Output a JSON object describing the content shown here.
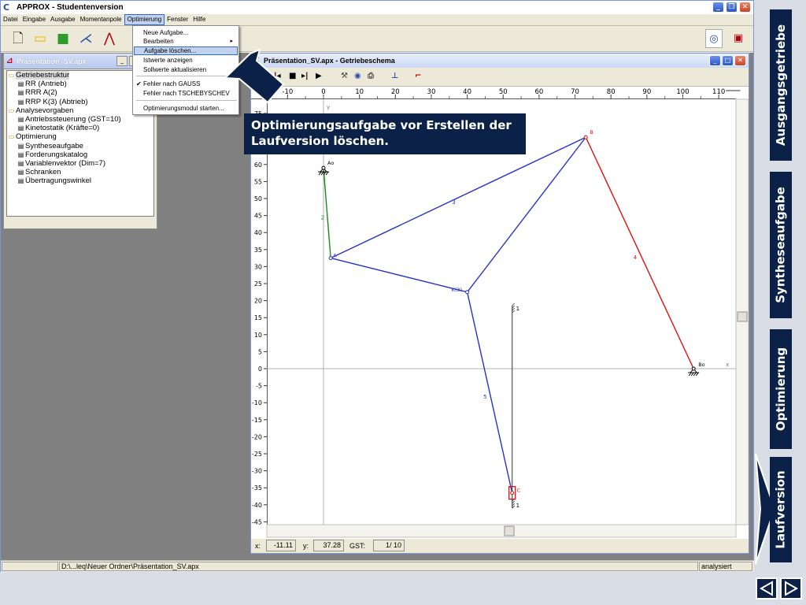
{
  "app": {
    "title": "APPROX - Studentenversion",
    "icon": "approx-logo-icon",
    "window_buttons": [
      "minimize-icon",
      "restore-icon",
      "close-icon"
    ]
  },
  "menubar": {
    "items": [
      "Datei",
      "Eingabe",
      "Ausgabe",
      "Momentanpole",
      "Optimierung",
      "Fenster",
      "Hilfe"
    ],
    "active": "Optimierung"
  },
  "optimierung_menu": {
    "items": [
      {
        "label": "Neue Aufgabe..."
      },
      {
        "label": "Bearbeiten",
        "submenu": true
      },
      {
        "label": "Aufgabe löschen...",
        "highlighted": true
      },
      {
        "label": "Istwerte anzeigen"
      },
      {
        "label": "Sollwerte aktualisieren"
      },
      {
        "label": "Fehler nach GAUSS",
        "checked": true
      },
      {
        "label": "Fehler nach TSCHEBYSCHEV"
      },
      {
        "label": "Optimierungsmodul starten..."
      }
    ]
  },
  "toolbar": {
    "icons": [
      "new-file-icon",
      "open-folder-icon",
      "save-disk-icon",
      "mechanism-icon",
      "synthesis-icon",
      "tud-logo-icon",
      "info-icon"
    ]
  },
  "tree_window": {
    "title": "Präsentation_SV.apx",
    "nodes": [
      {
        "label": "Getriebestruktur",
        "level": 0,
        "selected": true
      },
      {
        "label": "RR (Antrieb)",
        "level": 1
      },
      {
        "label": "RRR A(2)",
        "level": 1
      },
      {
        "label": "RRP K(3) (Abtrieb)",
        "level": 1
      },
      {
        "label": "Analysevorgaben",
        "level": 0
      },
      {
        "label": "Antriebssteuerung (GST=10)",
        "level": 1
      },
      {
        "label": "Kinetostatik (Kräfte=0)",
        "level": 1
      },
      {
        "label": "Optimierung",
        "level": 0
      },
      {
        "label": "Syntheseaufgabe",
        "level": 1
      },
      {
        "label": "Forderungskatalog",
        "level": 1
      },
      {
        "label": "Variablenvektor (Dim=7)",
        "level": 1
      },
      {
        "label": "Schranken",
        "level": 1
      },
      {
        "label": "Übertragungswinkel",
        "level": 1
      }
    ]
  },
  "gear_window": {
    "title": "Präsentation_SV.apx - Getriebeschema",
    "x_ticks": [
      "-10",
      "0",
      "10",
      "20",
      "30",
      "40",
      "50",
      "60",
      "70",
      "80",
      "90",
      "100",
      "110"
    ],
    "y_ticks": [
      "75",
      "70",
      "65",
      "60",
      "55",
      "50",
      "45",
      "40",
      "35",
      "30",
      "25",
      "20",
      "15",
      "10",
      "5",
      "0",
      "-5",
      "-10",
      "-15",
      "-20",
      "-25",
      "-30",
      "-35",
      "-40",
      "-45"
    ],
    "axis_labels": {
      "x": "x",
      "y": "y"
    },
    "points": [
      {
        "label": "Ao",
        "x": 0,
        "y": 59,
        "color": "#000000"
      },
      {
        "label": "A",
        "x": 2,
        "y": 32.5,
        "color": "#2a32c8"
      },
      {
        "label": "B",
        "x": 73,
        "y": 68,
        "color": "#e01010"
      },
      {
        "label": "Bo",
        "x": 103,
        "y": 0,
        "color": "#000000"
      },
      {
        "label": "K(3)",
        "x": 40,
        "y": 22.5,
        "color": "#2a32c8"
      },
      {
        "label": "C",
        "x": 52.5,
        "y": -36.5,
        "color": "#e01010"
      }
    ],
    "links": [
      {
        "label": "2",
        "from": "Ao",
        "to": "A",
        "color": "#1a8a1a"
      },
      {
        "label": "3",
        "from": "A",
        "to": "B",
        "color": "#2a32c8"
      },
      {
        "label": "3",
        "from": "A",
        "to": "K(3)",
        "color": "#2a32c8"
      },
      {
        "label": "3",
        "from": "B",
        "to": "K(3)",
        "color": "#2a32c8"
      },
      {
        "label": "5",
        "from": "K(3)",
        "to": "C",
        "color": "#2a32c8"
      },
      {
        "label": "4",
        "from": "B",
        "to": "Bo",
        "color": "#e01010"
      }
    ],
    "slider": {
      "label": "1",
      "x": 52.5,
      "y_top": 18.5,
      "y_bottom": -41
    },
    "status": {
      "x_label": "x:",
      "x_value": "-11.11",
      "y_label": "y:",
      "y_value": "37.28",
      "gst_label": "GST:",
      "gst_value": "1/ 10"
    }
  },
  "callout": {
    "text": "Optimierungsaufgabe vor Erstellen der Laufversion löschen."
  },
  "statusbar": {
    "path": "D:\\...leq\\Neuer Ordner\\Präsentation_SV.apx",
    "state": "analysiert"
  },
  "side_nav": {
    "tabs": [
      "Ausgangsgetriebe",
      "Syntheseaufgabe",
      "Optimierung",
      "Laufversion"
    ],
    "active": "Laufversion",
    "arrows": [
      "prev-arrow-icon",
      "next-arrow-icon"
    ]
  },
  "colors": {
    "nav_navy": "#0c2147",
    "link_blue": "#2a32c8",
    "link_red": "#e01010",
    "link_green": "#1a8a1a"
  }
}
